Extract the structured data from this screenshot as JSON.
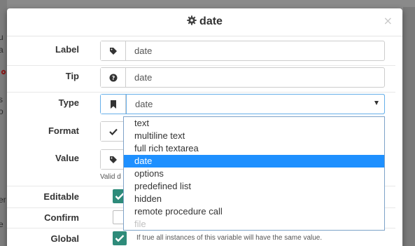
{
  "background": {
    "fragments": [
      "u",
      "a",
      "s",
      "o",
      "er",
      "e"
    ]
  },
  "modal": {
    "title": "date",
    "title_icon": "gear-icon",
    "close_label": "×"
  },
  "fields": {
    "label": {
      "label": "Label",
      "value": "date",
      "icon": "tag-icon"
    },
    "tip": {
      "label": "Tip",
      "value": "date",
      "icon": "question-circle-icon"
    },
    "type": {
      "label": "Type",
      "value": "date",
      "icon": "bookmark-icon"
    },
    "format": {
      "label": "Format",
      "icon": "check-icon"
    },
    "value": {
      "label": "Value",
      "icon": "tag-icon",
      "help": "Valid d"
    },
    "editable": {
      "label": "Editable",
      "checked": true
    },
    "confirm": {
      "label": "Confirm",
      "checked": false
    },
    "global": {
      "label": "Global",
      "checked": true,
      "help": "If true all instances of this variable will have the same value."
    }
  },
  "type_options": [
    {
      "label": "text",
      "state": "normal"
    },
    {
      "label": "multiline text",
      "state": "normal"
    },
    {
      "label": "full rich textarea",
      "state": "normal"
    },
    {
      "label": "date",
      "state": "selected"
    },
    {
      "label": "options",
      "state": "normal"
    },
    {
      "label": "predefined list",
      "state": "normal"
    },
    {
      "label": "hidden",
      "state": "normal"
    },
    {
      "label": "remote procedure call",
      "state": "normal"
    },
    {
      "label": "file",
      "state": "disabled"
    }
  ],
  "colors": {
    "accent": "#2e8b7a",
    "selected_option": "#1e90ff",
    "focus_border": "#66afe9"
  }
}
